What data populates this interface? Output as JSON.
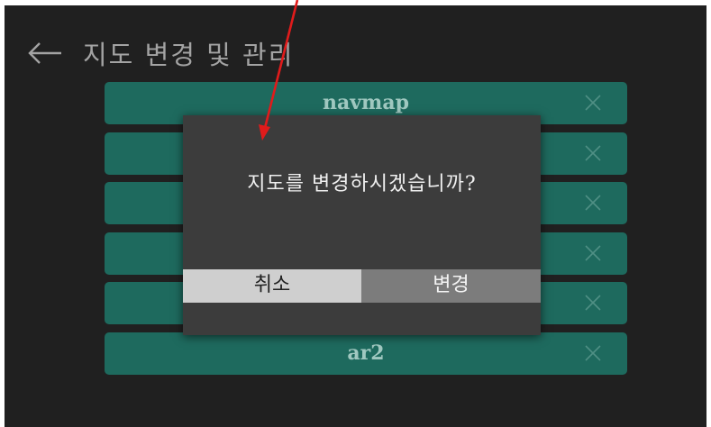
{
  "header": {
    "back_icon": "arrow-left-icon",
    "title": "지도 변경 및 관리"
  },
  "map_list": [
    {
      "label": "navmap",
      "delete_icon": "close-icon"
    },
    {
      "label": "",
      "delete_icon": "close-icon"
    },
    {
      "label": "",
      "delete_icon": "close-icon"
    },
    {
      "label": "",
      "delete_icon": "close-icon"
    },
    {
      "label": "",
      "delete_icon": "close-icon"
    },
    {
      "label": "ar2",
      "delete_icon": "close-icon"
    }
  ],
  "dialog": {
    "message": "지도를 변경하시겠습니까?",
    "cancel_label": "취소",
    "confirm_label": "변경"
  },
  "annotation": {
    "type": "red-arrow",
    "color": "#e01b1b"
  },
  "colors": {
    "screen_background": "#202020",
    "list_item": "#1e6a5e",
    "dialog_background": "#3c3c3c",
    "cancel_button": "#cfcfcf",
    "confirm_button": "#7c7c7c"
  }
}
